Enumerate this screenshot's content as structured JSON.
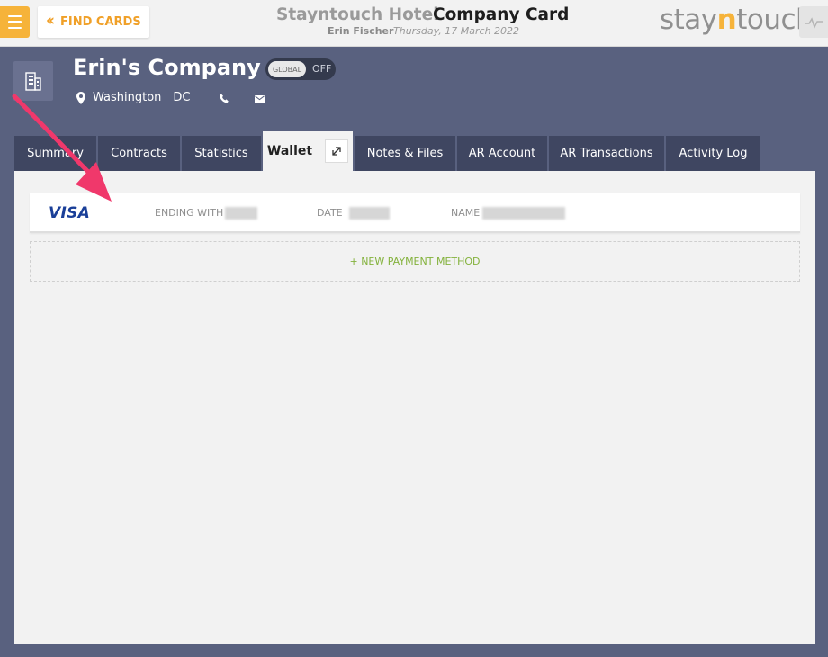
{
  "topbar": {
    "find_cards_label": "FIND CARDS",
    "hotel_name": "Stayntouch Hotel",
    "page_title": "Company Card",
    "user_name": "Erin Fischer",
    "date": "Thursday, 17 March 2022",
    "logo": {
      "pre": "stay",
      "n": "n",
      "post": "touch"
    }
  },
  "company": {
    "name": "Erin's Company",
    "global_toggle": {
      "knob_label": "GLOBAL",
      "state_label": "OFF"
    },
    "city": "Washington",
    "state": "DC"
  },
  "tabs": [
    {
      "label": "Summary"
    },
    {
      "label": "Contracts"
    },
    {
      "label": "Statistics"
    },
    {
      "label": "Wallet",
      "active": true
    },
    {
      "label": "Notes & Files"
    },
    {
      "label": "AR Account"
    },
    {
      "label": "AR Transactions"
    },
    {
      "label": "Activity Log"
    }
  ],
  "wallet": {
    "card": {
      "brand": "VISA",
      "ending_label": "ENDING WITH",
      "date_label": "DATE",
      "name_label": "NAME"
    },
    "new_payment_label": "+ NEW PAYMENT METHOD"
  },
  "colors": {
    "accent": "#f6b33a",
    "page_bg": "#59617f",
    "tab_bg": "#3f4661",
    "annotation_arrow": "#f0386b",
    "new_payment": "#84b23d"
  }
}
